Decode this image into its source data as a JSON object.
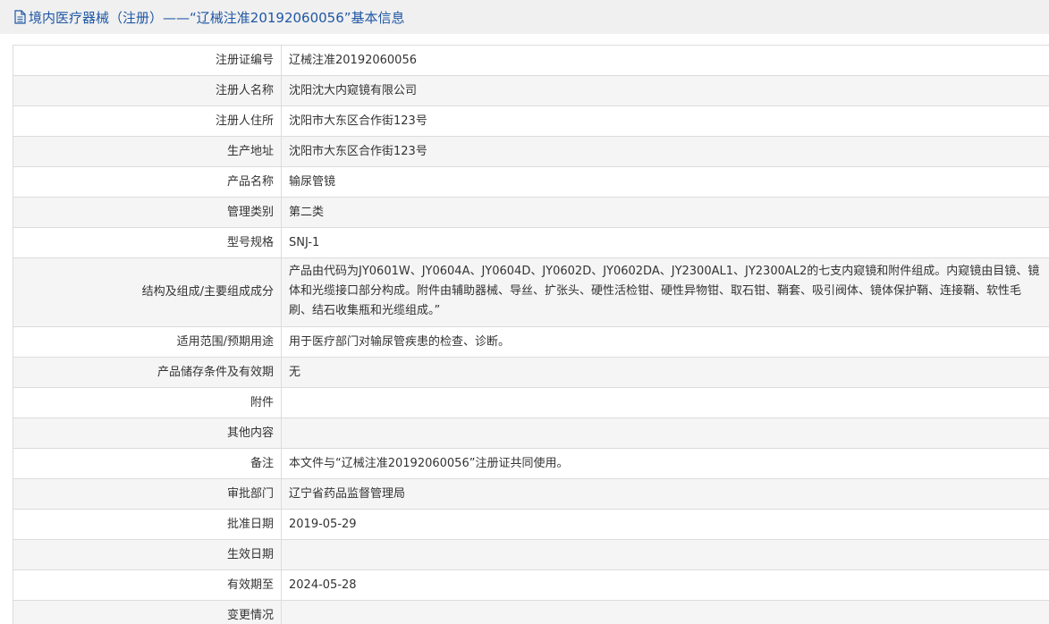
{
  "header": {
    "title": "境内医疗器械（注册）——“辽械注准20192060056”基本信息"
  },
  "rows": [
    {
      "key": "注册证编号",
      "value": "辽械注准20192060056"
    },
    {
      "key": "注册人名称",
      "value": "沈阳沈大内窥镜有限公司"
    },
    {
      "key": "注册人住所",
      "value": "沈阳市大东区合作街123号"
    },
    {
      "key": "生产地址",
      "value": "沈阳市大东区合作街123号"
    },
    {
      "key": "产品名称",
      "value": "输尿管镜"
    },
    {
      "key": "管理类别",
      "value": "第二类"
    },
    {
      "key": "型号规格",
      "value": "SNJ-1"
    },
    {
      "key": "结构及组成/主要组成成分",
      "value": "产品由代码为JY0601W、JY0604A、JY0604D、JY0602D、JY0602DA、JY2300AL1、JY2300AL2的七支内窥镜和附件组成。内窥镜由目镜、镜体和光缆接口部分构成。附件由辅助器械、导丝、扩张头、硬性活检钳、硬性异物钳、取石钳、鞘套、吸引阀体、镜体保护鞘、连接鞘、软性毛刷、结石收集瓶和光缆组成。”"
    },
    {
      "key": "适用范围/预期用途",
      "value": "用于医疗部门对输尿管疾患的检查、诊断。"
    },
    {
      "key": "产品储存条件及有效期",
      "value": "无"
    },
    {
      "key": "附件",
      "value": ""
    },
    {
      "key": "其他内容",
      "value": ""
    },
    {
      "key": "备注",
      "value": "本文件与“辽械注准20192060056”注册证共同使用。"
    },
    {
      "key": "审批部门",
      "value": "辽宁省药品监督管理局"
    },
    {
      "key": "批准日期",
      "value": "2019-05-29"
    },
    {
      "key": "生效日期",
      "value": ""
    },
    {
      "key": "有效期至",
      "value": "2024-05-28"
    },
    {
      "key": "变更情况",
      "value": ""
    }
  ]
}
